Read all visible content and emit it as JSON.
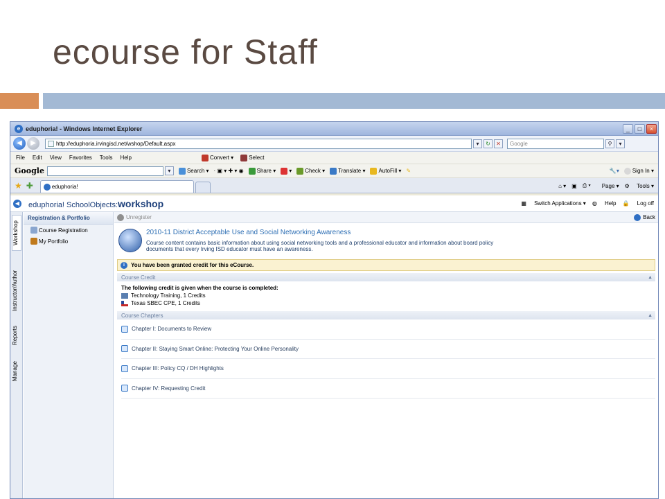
{
  "slide": {
    "title": "ecourse for Staff"
  },
  "browser": {
    "window_title": "eduphoria! - Windows Internet Explorer",
    "url": "http://eduphoria.irvingisd.net/wshop/Default.aspx",
    "search_placeholder": "Google",
    "menu": [
      "File",
      "Edit",
      "View",
      "Favorites",
      "Tools",
      "Help"
    ],
    "convert_label": "Convert",
    "select_label": "Select",
    "google_toolbar": {
      "logo": "Google",
      "search": "Search",
      "share": "Share",
      "check": "Check",
      "translate": "Translate",
      "autofill": "AutoFill",
      "sign_in": "Sign In"
    },
    "tab_label": "eduphoria!",
    "page_menu": "Page",
    "tools_menu": "Tools"
  },
  "app": {
    "logo_prefix": "eduphoria! SchoolObjects:",
    "logo_main": "workshop",
    "switch_applications": "Switch Applications",
    "help": "Help",
    "log_off": "Log off",
    "side_tabs": [
      "Workshop",
      "Instructor/Author",
      "Reports",
      "Manage"
    ],
    "left_panel": {
      "title": "Registration & Portfolio",
      "items": [
        {
          "label": "Course Registration",
          "icon": "computer-icon"
        },
        {
          "label": "My Portfolio",
          "icon": "portfolio-icon"
        }
      ]
    },
    "unregister": "Unregister",
    "back": "Back",
    "course": {
      "title": "2010-11 District Acceptable Use and Social Networking Awareness",
      "description_line1": "Course content contains basic information about using social networking tools and a professional educator and information about board policy",
      "description_line2": "documents that every Irving ISD educator must have an awareness."
    },
    "credit_notice": "You have been granted credit for this eCourse.",
    "course_credit_header": "Course Credit",
    "credit_lead": "The following credit is given when the course is completed:",
    "credits": [
      {
        "label": "Technology Training, 1 Credits"
      },
      {
        "label": "Texas SBEC CPE, 1 Credits"
      }
    ],
    "chapters_header": "Course Chapters",
    "chapters": [
      {
        "label": "Chapter I: Documents to Review"
      },
      {
        "label": "Chapter II: Staying Smart Online: Protecting Your Online Personality"
      },
      {
        "label": "Chapter III: Policy CQ / DH Highlights"
      },
      {
        "label": "Chapter IV: Requesting Credit"
      }
    ]
  }
}
